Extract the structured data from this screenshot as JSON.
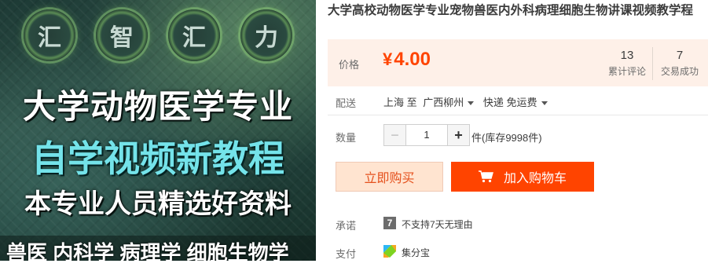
{
  "product_image": {
    "seals": [
      "汇",
      "智",
      "汇",
      "力"
    ],
    "line1": "大学动物医学专业",
    "line2": "自学视频新教程",
    "line3": "本专业人员精选好资料",
    "line4": "兽医 内科学 病理学 细胞生物学"
  },
  "product": {
    "title": "大学高校动物医学专业宠物兽医内外科病理细胞生物讲课视频教学程"
  },
  "price_panel": {
    "price_label": "价格",
    "currency": "¥",
    "price": "4.00",
    "reviews_count": "13",
    "reviews_label": "累计评论",
    "sales_count": "7",
    "sales_label": "交易成功"
  },
  "shipping": {
    "label": "配送",
    "from": "上海 至",
    "to": "广西柳州",
    "method": "快递 免运费"
  },
  "quantity": {
    "label": "数量",
    "minus": "−",
    "value": "1",
    "plus": "+",
    "stock": "件(库存9998件)"
  },
  "actions": {
    "buy_now": "立即购买",
    "add_to_cart": "加入购物车"
  },
  "promise": {
    "label": "承诺",
    "badge": "7",
    "text": "不支持7天无理由"
  },
  "payment": {
    "label": "支付",
    "text": "集分宝"
  },
  "colors": {
    "accent": "#ff4400",
    "price_panel_bg": "#fef0e8",
    "buy_now_bg": "#ffe4d0"
  },
  "icons": [
    "cart-icon",
    "promise-7day-icon",
    "jifenbao-icon",
    "caret-down-icon"
  ]
}
